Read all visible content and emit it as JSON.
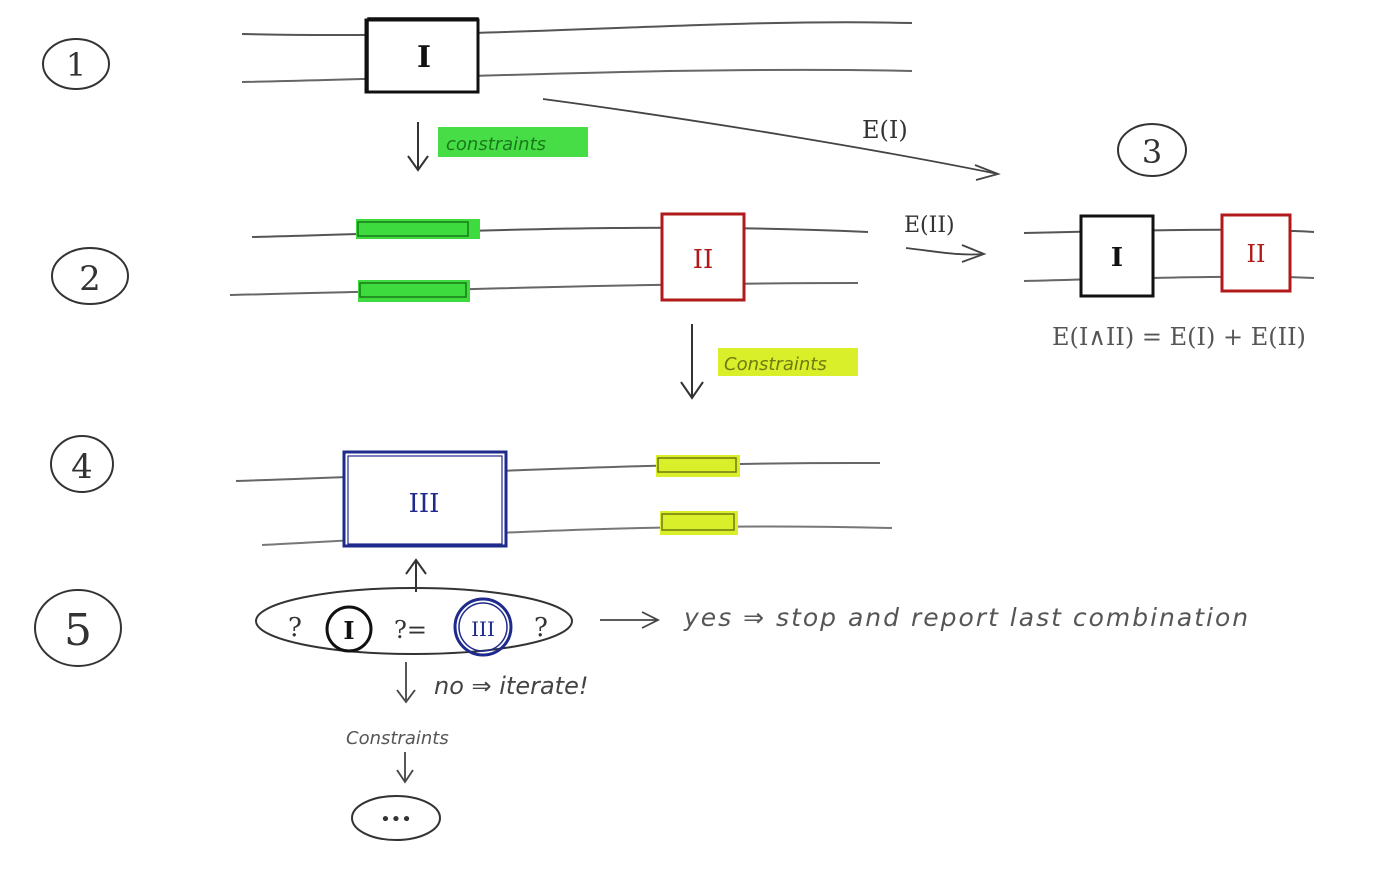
{
  "steps": {
    "s1": "1",
    "s2": "2",
    "s3": "3",
    "s4": "4",
    "s5": "5"
  },
  "boxes": {
    "I": "I",
    "II": "II",
    "III": "III"
  },
  "labels": {
    "constraints_green": "constraints",
    "constraints_yellow": "Constraints",
    "constraints_bottom": "Constraints",
    "energy_I": "E(I)",
    "energy_II": "E(II)",
    "energy_sum": "E(I∧II) = E(I) + E(II)"
  },
  "decision": {
    "q_left": "?",
    "q_right": "?",
    "eq": "?=",
    "yes_text": "yes ⇒ stop and report last combination",
    "no_text": "no ⇒ iterate!",
    "ellipsis": "•••"
  },
  "colors": {
    "ink": "#222222",
    "pencil": "#8a8a8a",
    "red": "#b01a1a",
    "blue": "#1e2a8c",
    "green": "#3ddb3d",
    "yellow": "#d8ef2a"
  }
}
